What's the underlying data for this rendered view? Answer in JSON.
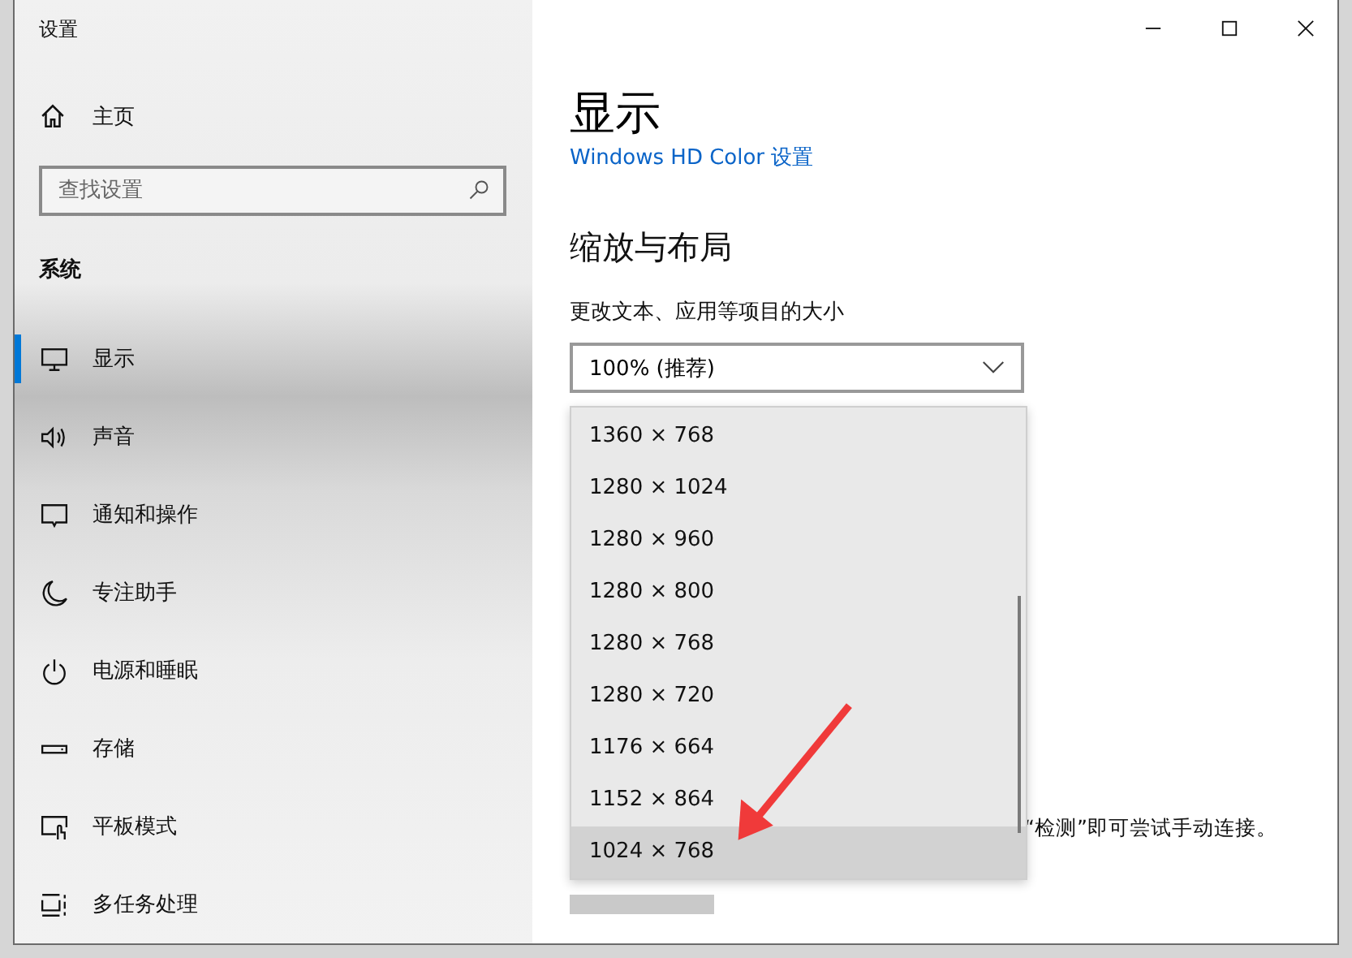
{
  "window": {
    "title": "设置"
  },
  "sidebar": {
    "home": "主页",
    "search": {
      "placeholder": "查找设置"
    },
    "section": "系统",
    "items": [
      {
        "label": "显示",
        "selected": true
      },
      {
        "label": "声音",
        "selected": false
      },
      {
        "label": "通知和操作",
        "selected": false
      },
      {
        "label": "专注助手",
        "selected": false
      },
      {
        "label": "电源和睡眠",
        "selected": false
      },
      {
        "label": "存储",
        "selected": false
      },
      {
        "label": "平板模式",
        "selected": false
      },
      {
        "label": "多任务处理",
        "selected": false
      }
    ]
  },
  "content": {
    "title": "显示",
    "hd_color_link": "Windows HD Color 设置",
    "section": "缩放与布局",
    "scale_label": "更改文本、应用等项目的大小",
    "scale_value": "100% (推荐)",
    "resolution_options": [
      {
        "label": "1360 × 768",
        "selected": false
      },
      {
        "label": "1280 × 1024",
        "selected": false
      },
      {
        "label": "1280 × 960",
        "selected": false
      },
      {
        "label": "1280 × 800",
        "selected": false
      },
      {
        "label": "1280 × 768",
        "selected": false
      },
      {
        "label": "1280 × 720",
        "selected": false
      },
      {
        "label": "1176 × 664",
        "selected": false
      },
      {
        "label": "1152 × 864",
        "selected": false
      },
      {
        "label": "1024 × 768",
        "selected": true
      }
    ],
    "detect_hint": "“检测”即可尝试手动连接。"
  }
}
